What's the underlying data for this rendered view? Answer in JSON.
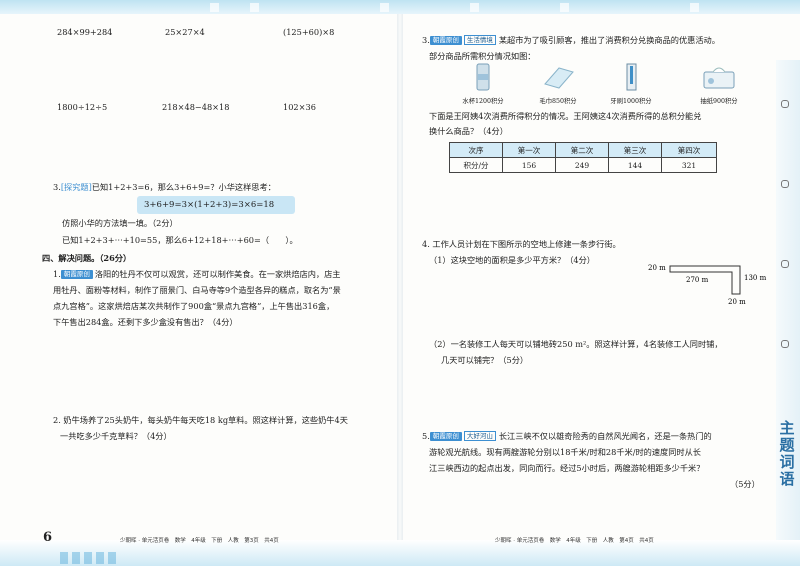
{
  "left": {
    "calc_row1": [
      "284×99+284",
      "25×27×4",
      "(125+60)×8"
    ],
    "calc_row2": [
      "1800÷12÷5",
      "218×48−48×18",
      "102×36"
    ],
    "q3_num": "3.",
    "q3_tag": "[探究题]",
    "q3_line1": "已知1+2+3=6，那么3+6+9=？小华这样思考：",
    "q3_box": "3+6+9=3×(1+2+3)=3×6=18",
    "q3_line2": "仿照小华的方法填一填。（2分）",
    "q3_line3": "已知1+2+3+⋯+10=55，那么6+12+18+⋯+60=（　　）。",
    "section4": "四、解决问题。（26分）",
    "p1_num": "1.",
    "p1_tag": "朝霞原创",
    "p1_l1": "洛阳的牡丹不仅可以观赏，还可以制作美食。在一家烘焙店内，店主",
    "p1_l2": "用牡丹、面粉等材料，制作了丽景门、白马寺等9个造型各异的糕点，取名为“景",
    "p1_l3": "点九宫格”。这家烘焙店某次共制作了900盒“景点九宫格”，上午售出316盒，",
    "p1_l4": "下午售出284盒。还剩下多少盒没有售出？（4分）",
    "p2_l1": "2. 奶牛场养了25头奶牛，每头奶牛每天吃18 kg草料。照这样计算，这些奶牛4天",
    "p2_l2": "一共吃多少千克草料？（4分）",
    "page_number": "6",
    "footer": "少朝晖 · 单元活页卷　数学　4年级　下册　人教　第3页　共4页"
  },
  "right": {
    "p3_num": "3.",
    "p3_tag1": "朝霞原创",
    "p3_tag2": "生活情境",
    "p3_l1": "某超市为了吸引顾客，推出了消费积分兑换商品的优惠活动。",
    "p3_l2": "部分商品所需积分情况如图：",
    "products": [
      {
        "caption": "水杯1200积分",
        "icon": "cup-icon"
      },
      {
        "caption": "毛巾850积分",
        "icon": "towel-icon"
      },
      {
        "caption": "牙刷1000积分",
        "icon": "toothbrush-icon"
      },
      {
        "caption": "抽纸900积分",
        "icon": "tissue-icon"
      }
    ],
    "p3_l3": "下面是王阿姨4次消费所得积分的情况。王阿姨这4次消费所得的总积分能兑",
    "p3_l4": "换什么商品？（4分）",
    "table_head": [
      "次序",
      "第一次",
      "第二次",
      "第三次",
      "第四次"
    ],
    "table_row": [
      "积分/分",
      "156",
      "249",
      "144",
      "321"
    ],
    "p4_l1": "4. 工作人员计划在下图所示的空地上修建一条步行街。",
    "p4_l2": "（1）这块空地的面积是多少平方米？（4分）",
    "fig_labels": [
      "20 m",
      "270 m",
      "130 m",
      "20 m"
    ],
    "p4_l3": "（2）一名装修工人每天可以铺地砖250 m²。照这样计算，4名装修工人同时铺，",
    "p4_l4": "几天可以铺完？（5分）",
    "p5_num": "5.",
    "p5_tag1": "朝霞原创",
    "p5_tag2": "大好河山",
    "p5_l1": "长江三峡不仅以雄奇险秀的自然风光闻名，还是一条热门的",
    "p5_l2": "游轮观光航线。现有两艘游轮分别以18千米/时和28千米/时的速度同时从长",
    "p5_l3": "江三峡西边的起点出发，同向而行。经过5小时后，两艘游轮相距多少千米？",
    "p5_score": "（5分）",
    "footer": "少朝晖 · 单元活页卷　数学　4年级　下册　人教　第4页　共4页"
  },
  "side_brush": [
    "主",
    "题",
    "词",
    "语"
  ],
  "colors": {
    "accent": "#3d8fd1",
    "box": "#c9e6f5",
    "band": "#bfe3f2"
  }
}
